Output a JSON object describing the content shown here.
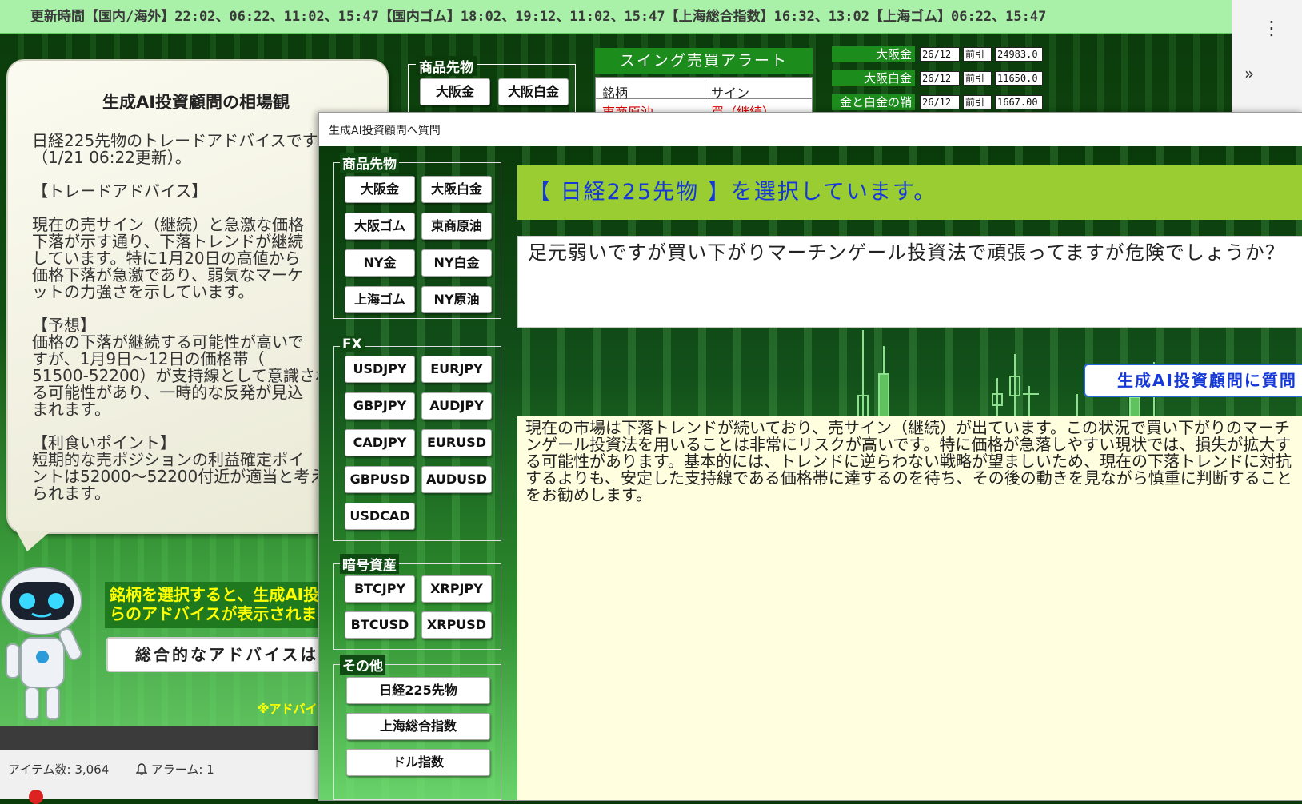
{
  "topbar": {
    "text": "更新時間【国内/海外】22:02、06:22、11:02、15:47【国内ゴム】18:02、19:12、11:02、15:47【上海総合指数】16:32、13:02【上海ゴム】06:22、15:47"
  },
  "browser": {
    "menu_icon": "⋮",
    "more_icon": "»"
  },
  "advice_bubble": {
    "title": "生成AI投資顧問の相場観",
    "text": "日経225先物のトレードアドバイスです\n（1/21 06:22更新）。\n\n【トレードアドバイス】\n\n現在の売サイン（継続）と急激な価格\n下落が示す通り、下落トレンドが継続\nしています。特に1月20日の高値から\n価格下落が急激であり、弱気なマーケ\nットの力強さを示しています。\n\n【予想】\n価格の下落が継続する可能性が高いで\nすが、1月9日～12日の価格帯（\n51500-52200）が支持線として意識され\nる可能性があり、一時的な反発が見込\nまれます。\n\n【利食いポイント】\n短期的な売ポジションの利益確定ポイ\nントは52000～52200付近が適当と考え\nられます。"
  },
  "promo": {
    "message": "銘柄を選択すると、生成AI投\nらのアドバイスが表示されます",
    "button": "総合的なアドバイスは",
    "note": "※アドバイ"
  },
  "statusbar": {
    "items": "アイテム数: 3,064",
    "alarm": "アラーム: 1"
  },
  "bg_commodities": {
    "label": "商品先物",
    "buttons": [
      "大阪金",
      "大阪白金"
    ]
  },
  "alert": {
    "title": "スイング売買アラート",
    "col_name": "銘柄",
    "col_sign": "サイン",
    "row_name": "東商原油",
    "row_sign": "買（継続）"
  },
  "prices": [
    {
      "name": "大阪金",
      "month": "26/12",
      "type": "前引",
      "value": "24983.0"
    },
    {
      "name": "大阪白金",
      "month": "26/12",
      "type": "前引",
      "value": "11650.0"
    },
    {
      "name": "金と白金の鞘",
      "month": "26/12",
      "type": "前引",
      "value": "1667.00"
    }
  ],
  "dialog": {
    "title": "生成AI投資顧問へ質問",
    "groups": {
      "commodities": {
        "label": "商品先物",
        "buttons": [
          "大阪金",
          "大阪白金",
          "大阪ゴム",
          "東商原油",
          "NY金",
          "NY白金",
          "上海ゴム",
          "NY原油"
        ]
      },
      "fx": {
        "label": "FX",
        "buttons": [
          "USDJPY",
          "EURJPY",
          "GBPJPY",
          "AUDJPY",
          "CADJPY",
          "EURUSD",
          "GBPUSD",
          "AUDUSD",
          "USDCAD"
        ]
      },
      "crypto": {
        "label": "暗号資産",
        "buttons": [
          "BTCJPY",
          "XRPJPY",
          "BTCUSD",
          "XRPUSD"
        ]
      },
      "other": {
        "label": "その他",
        "buttons": [
          "日経225先物",
          "上海総合指数",
          "ドル指数"
        ]
      }
    },
    "selection": "【 日経225先物 】を選択しています。",
    "question": "足元弱いですが買い下がりマーチンゲール投資法で頑張ってますが危険でしょうか？",
    "ask_button": "生成AI投資顧問に質問",
    "answer": "現在の市場は下落トレンドが続いており、売サイン（継続）が出ています。この状況で買い下がりのマーチンゲール投資法を用いることは非常にリスクが高いです。特に価格が急落しやすい現状では、損失が拡大する可能性があります。基本的には、トレンドに逆らわない戦略が望ましいため、現在の下落トレンドに対抗するよりも、安定した支持線である価格帯に達するのを待ち、その後の動きを見ながら慎重に判断することをお勧めします。"
  },
  "colors": {
    "banner": "#9acd32",
    "banner_text": "#1538d8",
    "answer_bg": "#ffffe0",
    "topbar": "#a9f0a9"
  }
}
